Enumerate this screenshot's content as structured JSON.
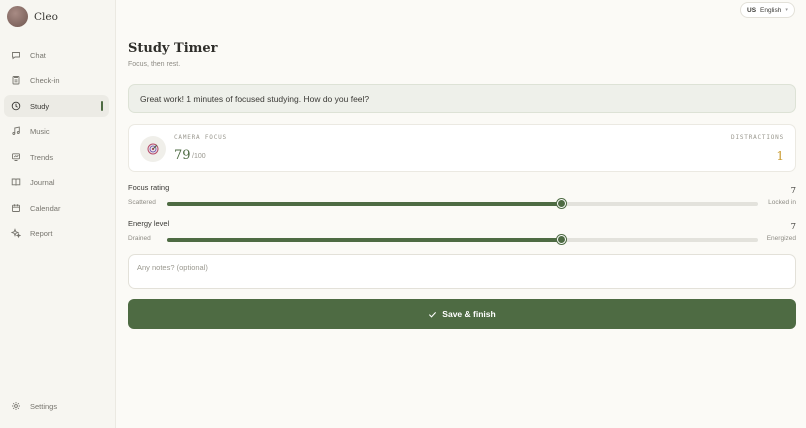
{
  "app": {
    "name": "Cleo"
  },
  "sidebar": {
    "items": [
      {
        "label": "Chat",
        "icon": "chat-icon"
      },
      {
        "label": "Check-in",
        "icon": "clipboard-icon"
      },
      {
        "label": "Study",
        "icon": "clock-icon",
        "active": true
      },
      {
        "label": "Music",
        "icon": "music-note-icon"
      },
      {
        "label": "Trends",
        "icon": "chart-icon"
      },
      {
        "label": "Journal",
        "icon": "book-icon"
      },
      {
        "label": "Calendar",
        "icon": "calendar-icon"
      },
      {
        "label": "Report",
        "icon": "sparkles-icon"
      }
    ],
    "settings_label": "Settings"
  },
  "language": {
    "flag": "US",
    "label": "English"
  },
  "page": {
    "title": "Study Timer",
    "subtitle": "Focus, then rest."
  },
  "banner": {
    "text": "Great work! 1 minutes of focused studying. How do you feel?"
  },
  "focus_card": {
    "camera_label": "CAMERA FOCUS",
    "score": "79",
    "score_max": "/100",
    "distractions_label": "DISTRACTIONS",
    "distractions_value": "1"
  },
  "focus_rating": {
    "label": "Focus rating",
    "value": "7",
    "min_label": "Scattered",
    "max_label": "Locked in",
    "fraction": 0.667
  },
  "energy_level": {
    "label": "Energy level",
    "value": "7",
    "min_label": "Drained",
    "max_label": "Energized",
    "fraction": 0.667
  },
  "notes": {
    "placeholder": "Any notes? (optional)",
    "value": ""
  },
  "save_button": {
    "label": "Save & finish"
  },
  "colors": {
    "accent": "#4e6b43",
    "distractions": "#c99a2e",
    "background": "#fbfaf6"
  }
}
